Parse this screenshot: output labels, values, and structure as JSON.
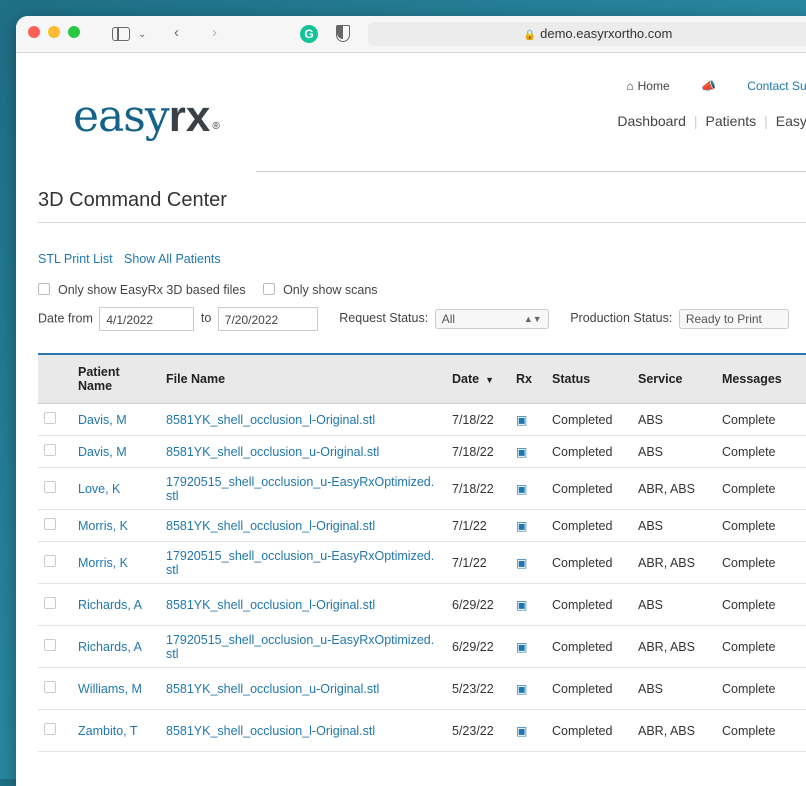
{
  "browser": {
    "url": "demo.easyrxortho.com"
  },
  "brand": {
    "logo_left": "easy",
    "logo_right": "rx",
    "logo_mark": "®"
  },
  "topnav": {
    "home": "Home",
    "contact": "Contact Supp"
  },
  "mainnav": {
    "dashboard": "Dashboard",
    "patients": "Patients",
    "easyrx": "EasyRx"
  },
  "page": {
    "title": "3D Command Center"
  },
  "links": {
    "stl_print_list": "STL Print List",
    "show_all_patients": "Show All Patients"
  },
  "filters": {
    "only_easyrx": "Only show EasyRx 3D based files",
    "only_scans": "Only show scans",
    "date_from_label": "Date from",
    "date_from_value": "4/1/2022",
    "to_label": "to",
    "date_to_value": "7/20/2022",
    "request_status_label": "Request Status:",
    "request_status_value": "All",
    "production_status_label": "Production Status:",
    "production_status_value": "Ready to Print"
  },
  "table": {
    "headers": {
      "patient": "Patient Name",
      "file": "File Name",
      "date": "Date",
      "rx": "Rx",
      "status": "Status",
      "service": "Service",
      "messages": "Messages"
    },
    "rows": [
      {
        "patient": "Davis, M",
        "file": "8581YK_shell_occlusion_l-Original.stl",
        "date": "7/18/22",
        "status": "Completed",
        "service": "ABS",
        "messages": "Complete"
      },
      {
        "patient": "Davis, M",
        "file": "8581YK_shell_occlusion_u-Original.stl",
        "date": "7/18/22",
        "status": "Completed",
        "service": "ABS",
        "messages": "Complete"
      },
      {
        "patient": "Love, K",
        "file": "17920515_shell_occlusion_u-EasyRxOptimized.stl",
        "date": "7/18/22",
        "status": "Completed",
        "service": "ABR, ABS",
        "messages": "Complete"
      },
      {
        "patient": "Morris, K",
        "file": "8581YK_shell_occlusion_l-Original.stl",
        "date": "7/1/22",
        "status": "Completed",
        "service": "ABS",
        "messages": "Complete"
      },
      {
        "patient": "Morris, K",
        "file": "17920515_shell_occlusion_u-EasyRxOptimized.stl",
        "date": "7/1/22",
        "status": "Completed",
        "service": "ABR, ABS",
        "messages": "Complete"
      },
      {
        "patient": "Richards, A",
        "file": "8581YK_shell_occlusion_l-Original.stl",
        "date": "6/29/22",
        "status": "Completed",
        "service": "ABS",
        "messages": "Complete"
      },
      {
        "patient": "Richards, A",
        "file": "17920515_shell_occlusion_u-EasyRxOptimized.stl",
        "date": "6/29/22",
        "status": "Completed",
        "service": "ABR, ABS",
        "messages": "Complete"
      },
      {
        "patient": "Williams, M",
        "file": "8581YK_shell_occlusion_u-Original.stl",
        "date": "5/23/22",
        "status": "Completed",
        "service": "ABS",
        "messages": "Complete"
      },
      {
        "patient": "Zambito, T",
        "file": "8581YK_shell_occlusion_l-Original.stl",
        "date": "5/23/22",
        "status": "Completed",
        "service": "ABR, ABS",
        "messages": "Complete"
      }
    ]
  }
}
